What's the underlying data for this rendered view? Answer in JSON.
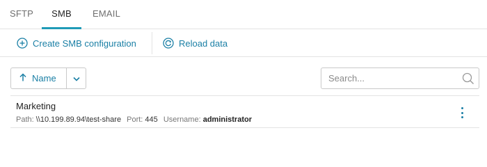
{
  "tabs": [
    {
      "label": "SFTP",
      "active": false
    },
    {
      "label": "SMB",
      "active": true
    },
    {
      "label": "EMAIL",
      "active": false
    }
  ],
  "toolbar": {
    "create_label": "Create SMB configuration",
    "reload_label": "Reload data"
  },
  "sort": {
    "label": "Name",
    "direction": "ascending"
  },
  "search": {
    "placeholder": "Search...",
    "value": ""
  },
  "items": [
    {
      "name": "Marketing",
      "path_label": "Path:",
      "path": "\\\\10.199.89.94\\test-share",
      "port_label": "Port:",
      "port": "445",
      "username_label": "Username:",
      "username": "administrator"
    }
  ],
  "colors": {
    "accent": "#1a7fa5",
    "tab_underline": "#1f9bb7",
    "border": "#e3e3e3"
  },
  "icons": {
    "create": "plus-circle-icon",
    "reload": "reload-icon",
    "sort": "arrow-up-icon",
    "sort_toggle": "chevron-down-icon",
    "search": "search-icon",
    "menu": "more-vertical-icon"
  }
}
